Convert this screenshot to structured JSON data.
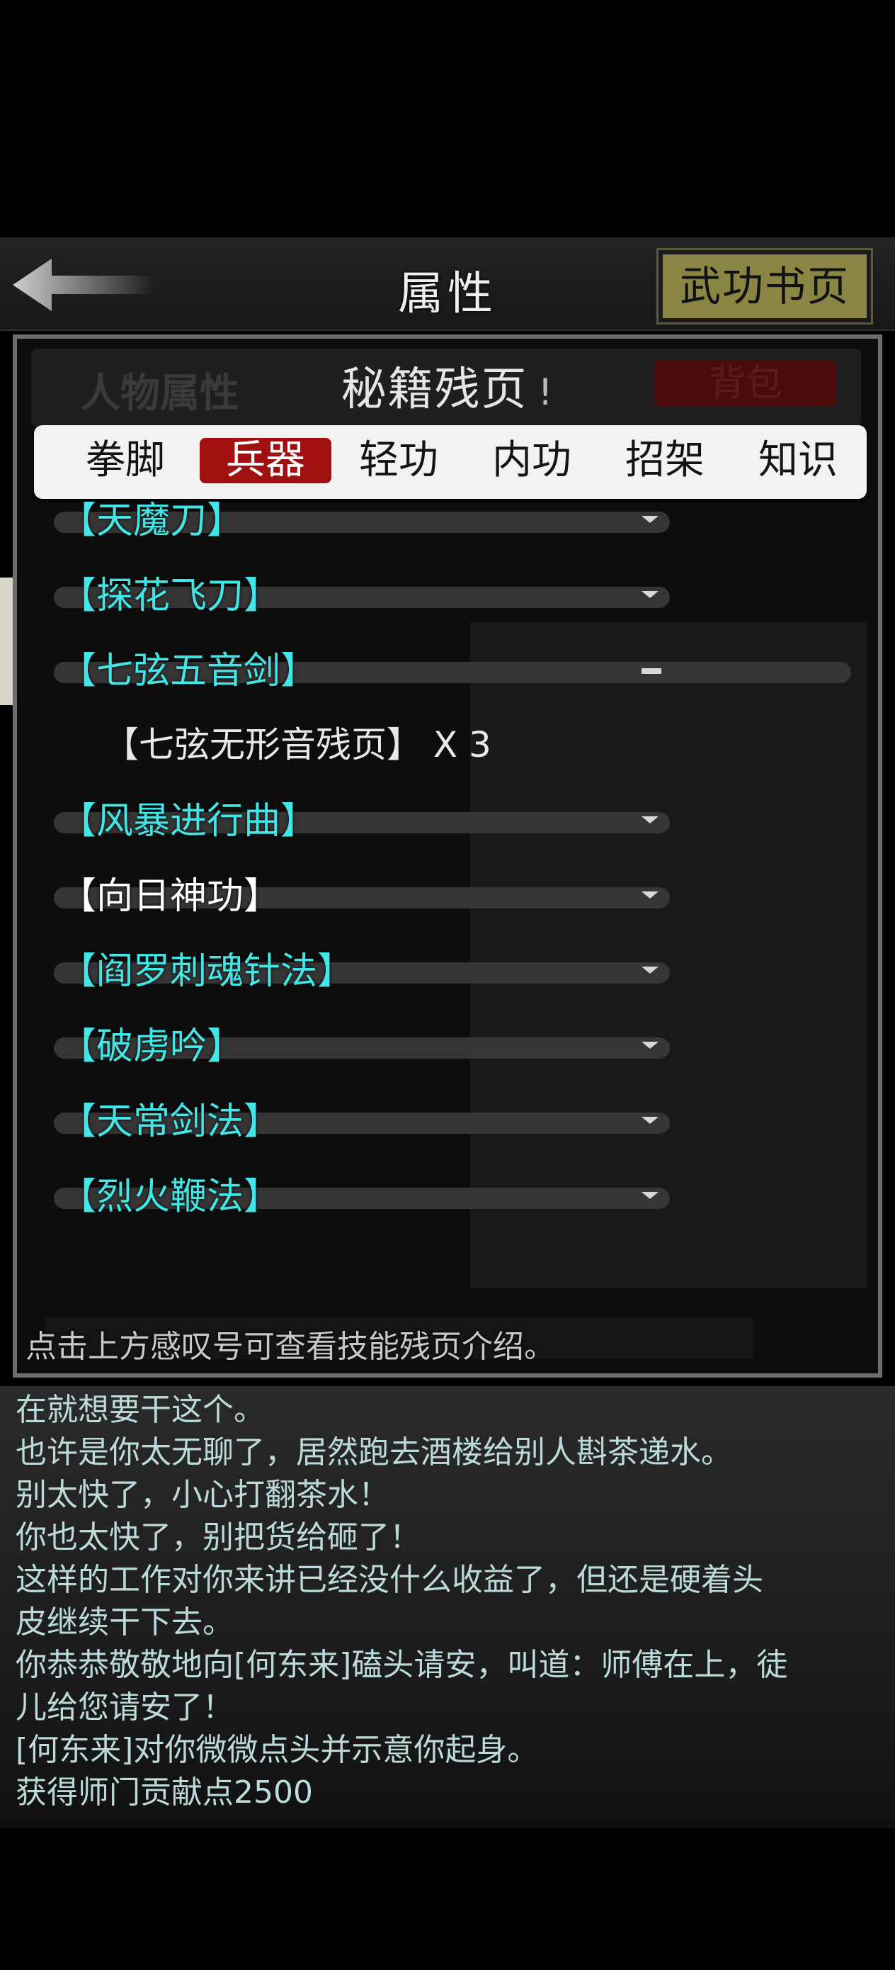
{
  "header": {
    "title": "属性",
    "right_button": "武功书页"
  },
  "panel": {
    "left_tab": "人物属性",
    "section_title": "秘籍残页",
    "section_bang": "!",
    "right_tab": "背包"
  },
  "tabs": [
    {
      "label": "拳脚",
      "active": false
    },
    {
      "label": "兵器",
      "active": true
    },
    {
      "label": "轻功",
      "active": false
    },
    {
      "label": "内功",
      "active": false
    },
    {
      "label": "招架",
      "active": false
    },
    {
      "label": "知识",
      "active": false
    }
  ],
  "skills": [
    {
      "name": "【天魔刀】",
      "color": "#43e6e6",
      "expanded": false
    },
    {
      "name": "【探花飞刀】",
      "color": "#43e6e6",
      "expanded": false
    },
    {
      "name": "【七弦五音剑】",
      "color": "#43e6e6",
      "expanded": true
    },
    {
      "name": "【风暴进行曲】",
      "color": "#43e6e6",
      "expanded": false
    },
    {
      "name": "【向日神功】",
      "color": "#ffffff",
      "expanded": false
    },
    {
      "name": "【阎罗刺魂针法】",
      "color": "#43e6e6",
      "expanded": false
    },
    {
      "name": "【破虏吟】",
      "color": "#43e6e6",
      "expanded": false
    },
    {
      "name": "【天常剑法】",
      "color": "#43e6e6",
      "expanded": false
    },
    {
      "name": "【烈火鞭法】",
      "color": "#43e6e6",
      "expanded": false
    }
  ],
  "sub_item": {
    "text": "【七弦无形音残页】  X 3"
  },
  "hint": "点击上方感叹号可查看技能残页介绍。",
  "log": [
    "在就想要干这个。",
    "也许是你太无聊了，居然跑去酒楼给别人斟茶递水。",
    "别太快了，小心打翻茶水！",
    "你也太快了，别把货给砸了！",
    "这样的工作对你来讲已经没什么收益了，但还是硬着头",
    "皮继续干下去。",
    "你恭恭敬敬地向[何东来]磕头请安，叫道：师傅在上，徒",
    "儿给您请安了！",
    "[何东来]对你微微点头并示意你起身。",
    "获得师门贡献点2500"
  ]
}
